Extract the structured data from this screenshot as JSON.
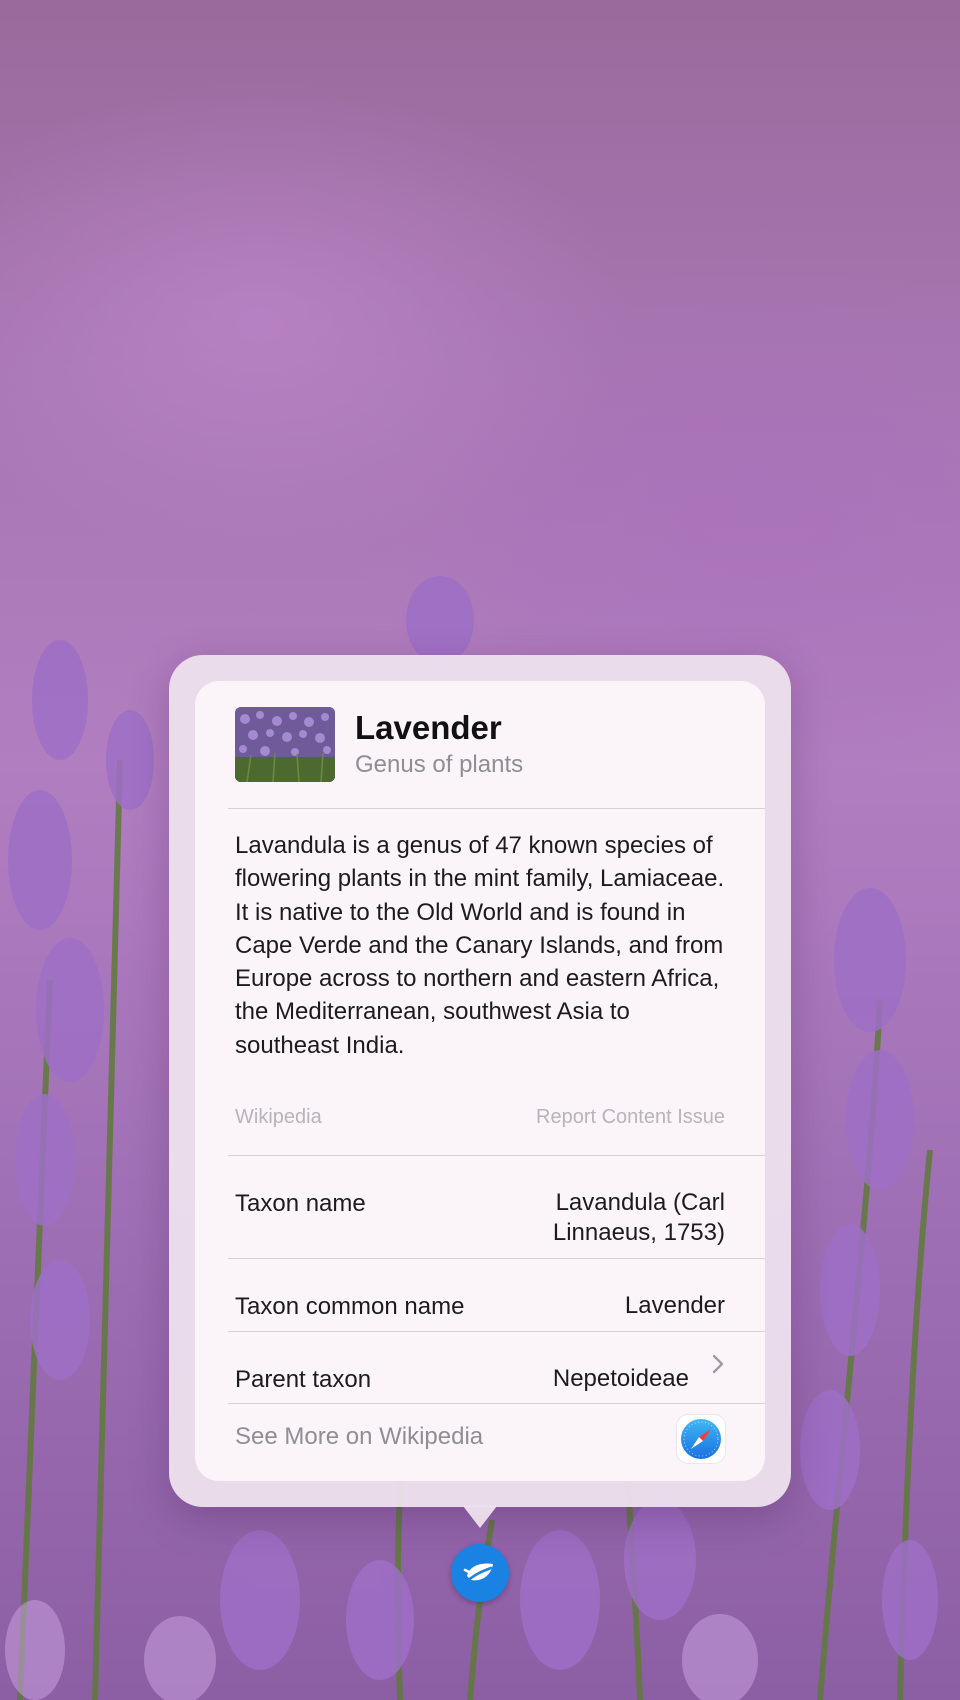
{
  "entity": {
    "title": "Lavender",
    "subtitle": "Genus of plants",
    "description": "Lavandula is a genus of 47 known species of flowering plants in the mint family, Lamiaceae. It is native to the Old World and is found in Cape Verde and the Canary Islands, and from Europe across to northern and eastern Africa, the Mediterranean, southwest Asia to southeast India.",
    "source": "Wikipedia",
    "report_link": "Report Content Issue"
  },
  "facts": [
    {
      "label": "Taxon name",
      "value_line1": "Lavandula (Carl",
      "value_line2": "Linnaeus, 1753)"
    },
    {
      "label": "Taxon common name",
      "value": "Lavender"
    },
    {
      "label": "Parent taxon",
      "value": "Nepetoideae"
    }
  ],
  "footer": {
    "see_more": "See More on Wikipedia"
  },
  "icons": {
    "thumbnail": "lavender-photo-thumbnail",
    "parent_chevron": "chevron-right-icon",
    "safari": "safari-compass-icon",
    "visual_lookup": "leaf-icon"
  },
  "colors": {
    "accent_blue": "#1a82e2",
    "card_background": "#fbf5fa",
    "secondary_text": "#8e8e93",
    "tertiary_text": "#b8b3ba"
  }
}
